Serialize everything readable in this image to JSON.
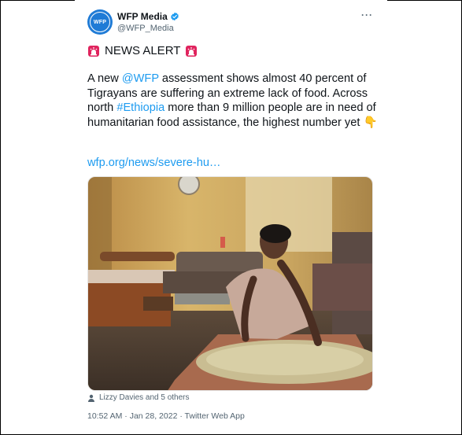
{
  "account": {
    "avatar_text": "WFP",
    "display_name": "WFP Media",
    "handle": "@WFP_Media",
    "verified": true
  },
  "menu": {
    "more_label": "···"
  },
  "tweet": {
    "alert_text": "NEWS ALERT",
    "body": {
      "p1": "A new ",
      "mention": "@WFP",
      "p2": " assessment shows almost 40 percent of Tigrayans are suffering an extreme lack of food. Across north ",
      "hashtag": "#Ethiopia",
      "p3": " more than 9 million people are in need of humanitarian food assistance, the highest number yet ",
      "emoji": "👇"
    },
    "link": "wfp.org/news/severe-hu…"
  },
  "media": {
    "tagged": "Lizzy Davies and 5 others"
  },
  "meta": {
    "timestamp": "10:52 AM · Jan 28, 2022 · Twitter Web App"
  },
  "colors": {
    "link": "#1d9bf0",
    "avatar": "#1f7bd6",
    "secondary_text": "#536471"
  }
}
